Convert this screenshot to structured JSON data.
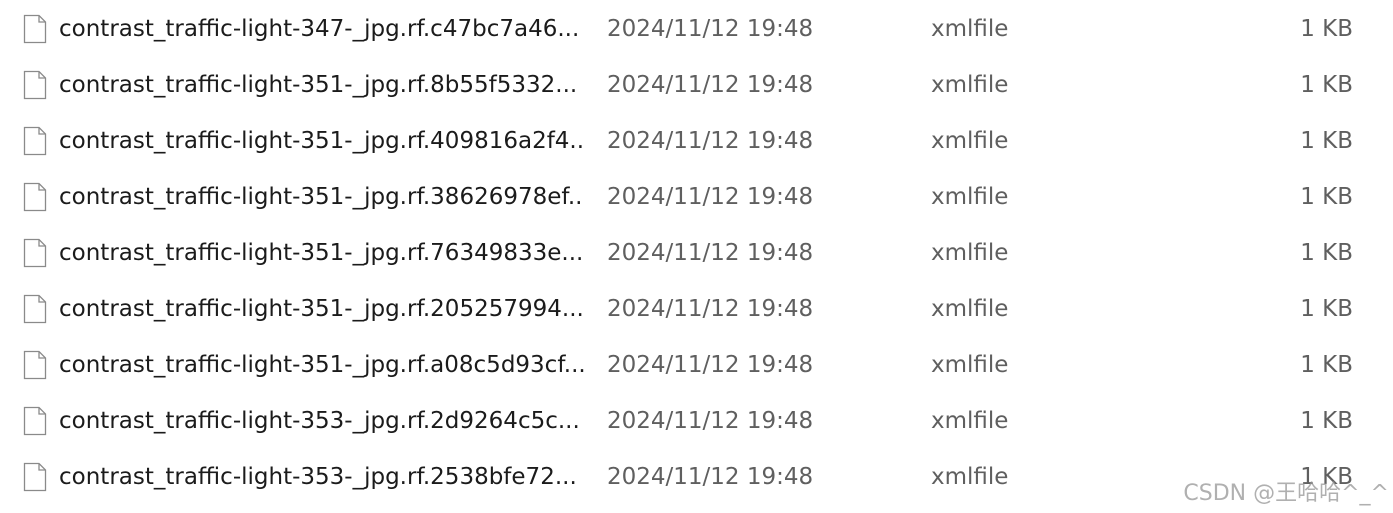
{
  "files": [
    {
      "icon": "file-icon",
      "name": "contrast_traffic-light-347-_jpg.rf.c47bc7a46...",
      "date": "2024/11/12 19:48",
      "type": "xmlfile",
      "size": "1 KB"
    },
    {
      "icon": "file-icon",
      "name": "contrast_traffic-light-351-_jpg.rf.8b55f5332...",
      "date": "2024/11/12 19:48",
      "type": "xmlfile",
      "size": "1 KB"
    },
    {
      "icon": "file-icon",
      "name": "contrast_traffic-light-351-_jpg.rf.409816a2f4...",
      "date": "2024/11/12 19:48",
      "type": "xmlfile",
      "size": "1 KB"
    },
    {
      "icon": "file-icon",
      "name": "contrast_traffic-light-351-_jpg.rf.38626978ef...",
      "date": "2024/11/12 19:48",
      "type": "xmlfile",
      "size": "1 KB"
    },
    {
      "icon": "file-icon",
      "name": "contrast_traffic-light-351-_jpg.rf.76349833e...",
      "date": "2024/11/12 19:48",
      "type": "xmlfile",
      "size": "1 KB"
    },
    {
      "icon": "file-icon",
      "name": "contrast_traffic-light-351-_jpg.rf.205257994...",
      "date": "2024/11/12 19:48",
      "type": "xmlfile",
      "size": "1 KB"
    },
    {
      "icon": "file-icon",
      "name": "contrast_traffic-light-351-_jpg.rf.a08c5d93cf...",
      "date": "2024/11/12 19:48",
      "type": "xmlfile",
      "size": "1 KB"
    },
    {
      "icon": "file-icon",
      "name": "contrast_traffic-light-353-_jpg.rf.2d9264c5c...",
      "date": "2024/11/12 19:48",
      "type": "xmlfile",
      "size": "1 KB"
    },
    {
      "icon": "file-icon",
      "name": "contrast_traffic-light-353-_jpg.rf.2538bfe72...",
      "date": "2024/11/12 19:48",
      "type": "xmlfile",
      "size": "1 KB"
    }
  ],
  "watermark": "CSDN @王哈哈^_^",
  "colors": {
    "name_text": "#1b1b1b",
    "meta_text": "#5f5f5f",
    "icon_stroke": "#8a8a8a",
    "background": "#ffffff"
  }
}
